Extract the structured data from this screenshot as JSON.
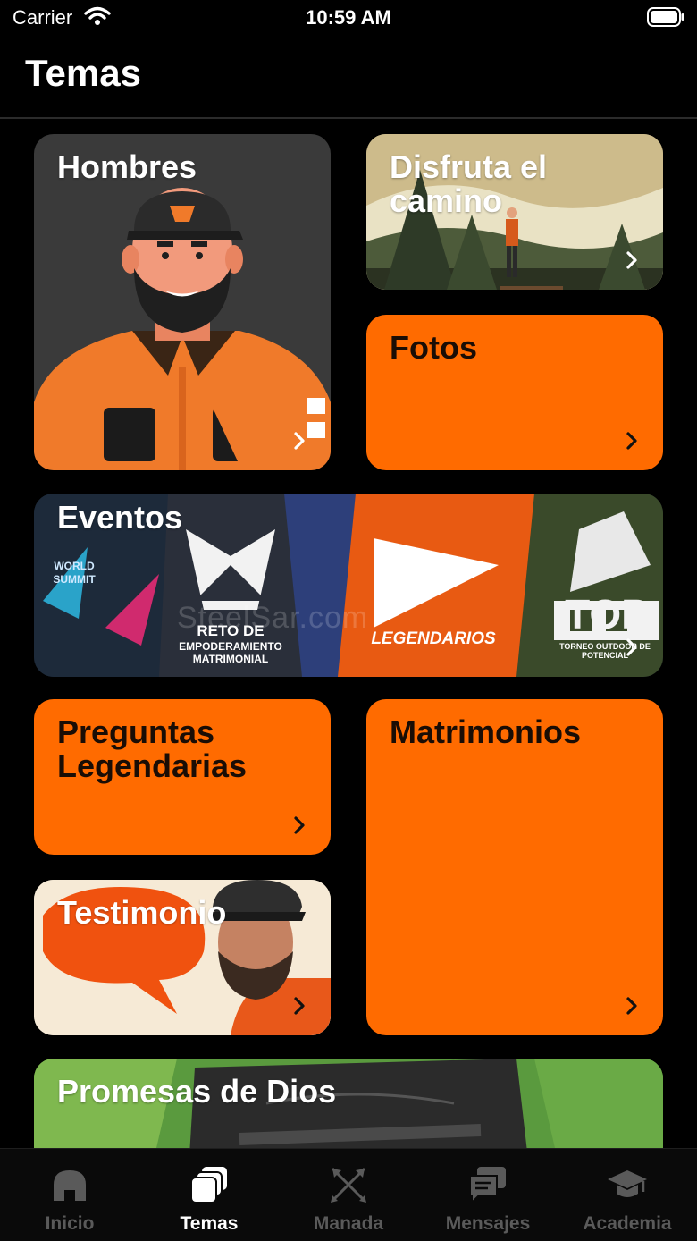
{
  "status_bar": {
    "carrier": "Carrier",
    "time": "10:59 AM"
  },
  "page_title": "Temas",
  "cards": {
    "hombres": "Hombres",
    "disfruta": "Disfruta el camino",
    "fotos": "Fotos",
    "eventos": "Eventos",
    "preguntas": "Preguntas Legendarias",
    "matrimonios": "Matrimonios",
    "testimonio": "Testimonio",
    "promesas": "Promesas de Dios"
  },
  "eventos_banner": {
    "reto_line1": "RETO DE",
    "reto_line2": "EMPODERAMIENTO",
    "reto_line3": "MATRIMONIAL",
    "legendarios": "LEGENDARIOS",
    "top": "TOP",
    "top_sub": "TORNEO OUTDOOR DE POTENCIAL",
    "summit": "WORLD SUMMIT",
    "watermark": "SteelSar.com"
  },
  "tab_bar": {
    "items": [
      "Inicio",
      "Temas",
      "Manada",
      "Mensajes",
      "Academia"
    ],
    "active": "Temas"
  },
  "colors": {
    "accent": "#ff6b00",
    "background": "#000000",
    "card_dark": "#3b3b3b"
  }
}
